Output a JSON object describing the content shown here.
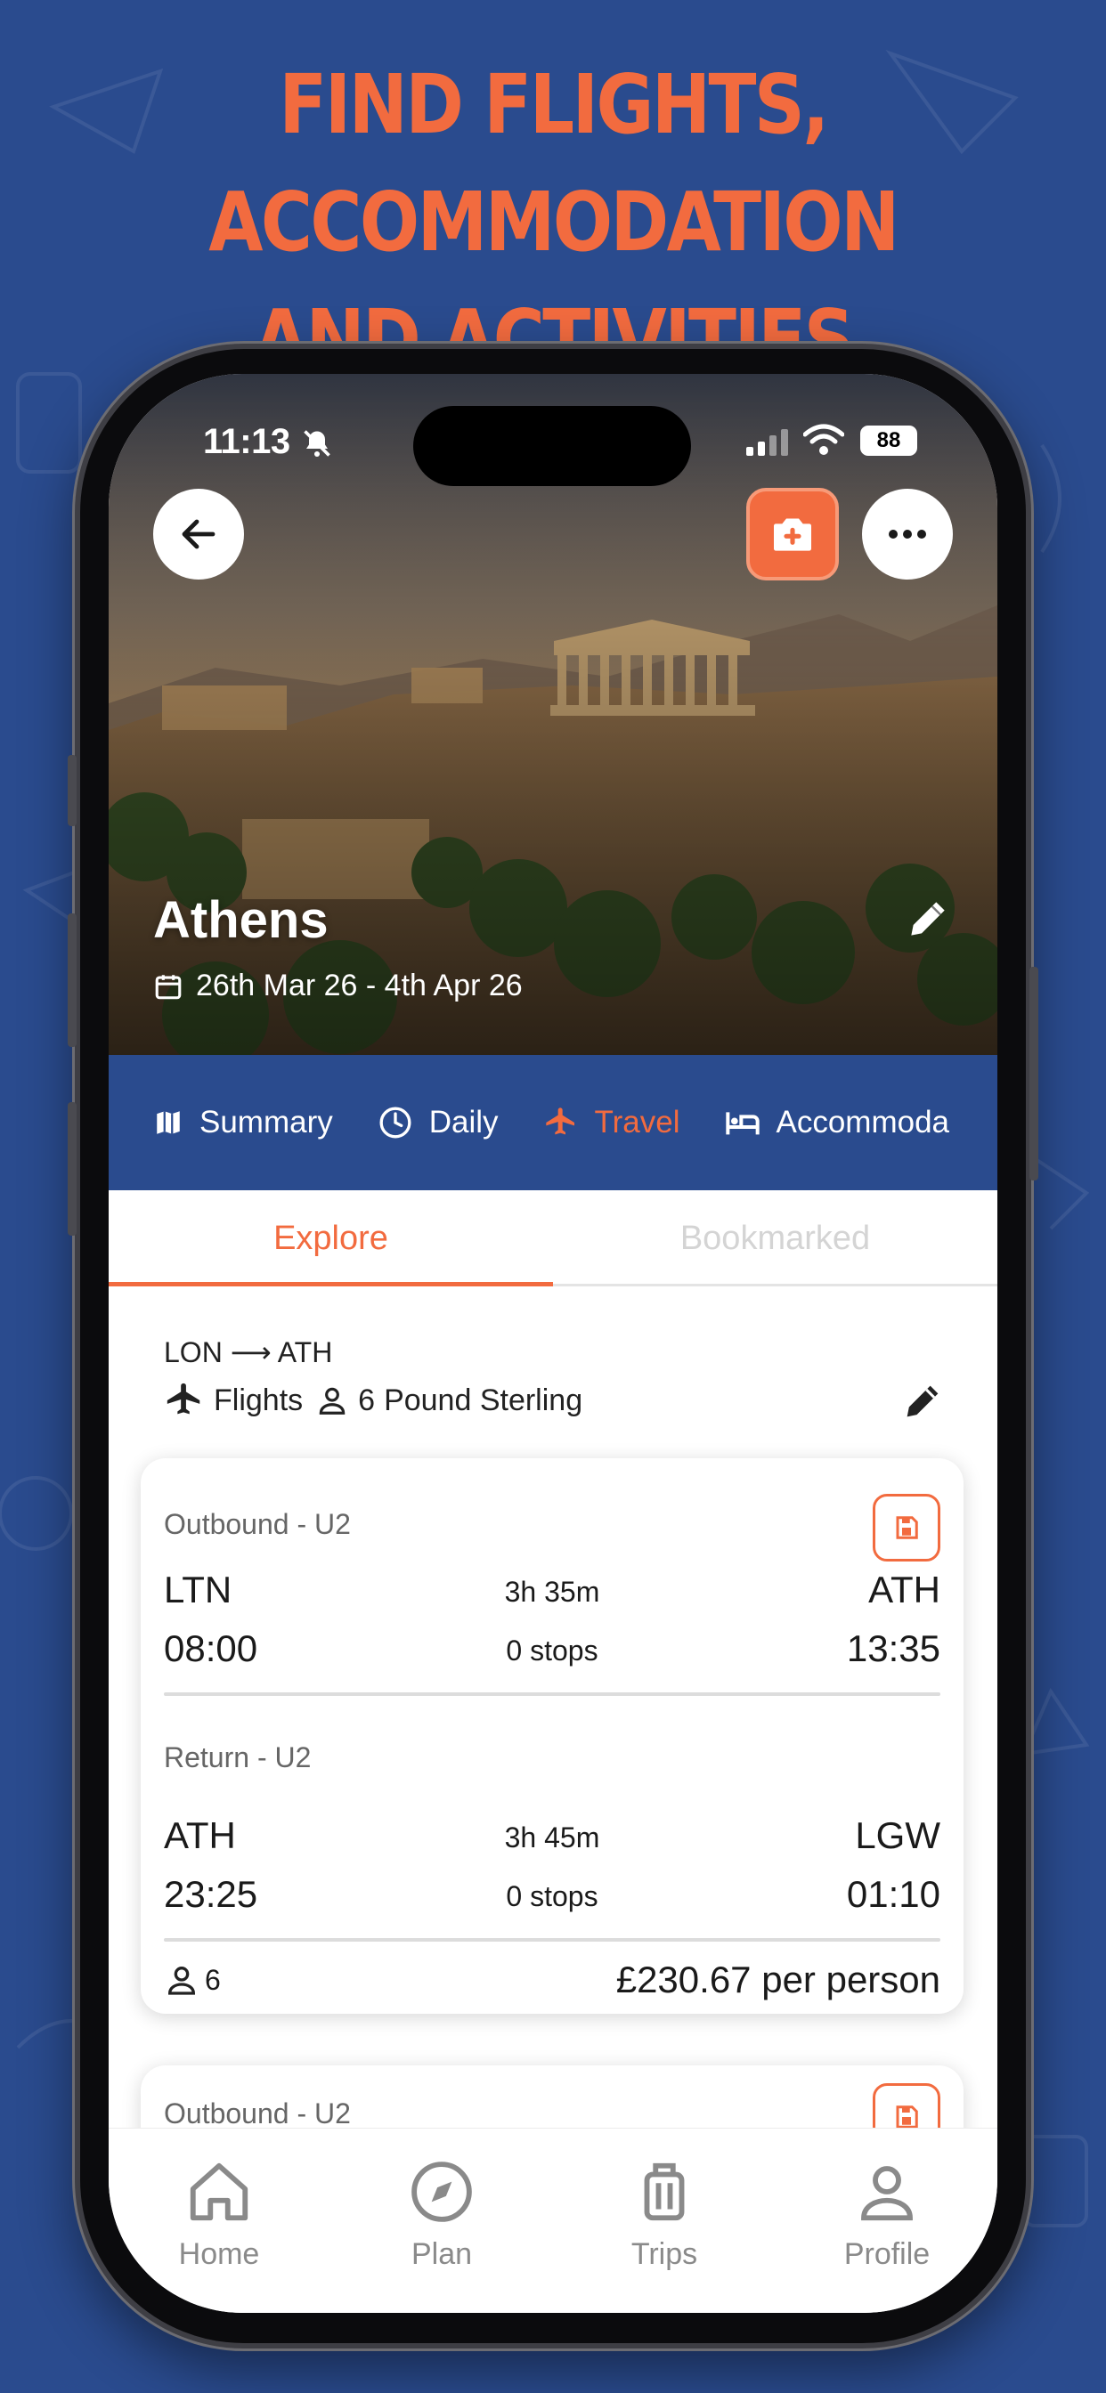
{
  "headline": {
    "line1": "FIND FLIGHTS, ACCOMMODATION",
    "line2": "AND ACTIVITIES"
  },
  "status_bar": {
    "time": "11:13",
    "battery": "88"
  },
  "trip": {
    "city": "Athens",
    "dates": "26th Mar 26 - 4th Apr 26"
  },
  "tabs": [
    {
      "label": "Summary",
      "icon": "map-icon"
    },
    {
      "label": "Daily",
      "icon": "clock-icon"
    },
    {
      "label": "Travel",
      "icon": "plane-icon",
      "active": true
    },
    {
      "label": "Accommoda",
      "icon": "bed-icon"
    }
  ],
  "subtabs": {
    "explore": "Explore",
    "bookmarked": "Bookmarked"
  },
  "search": {
    "route": "LON ⟶ ATH",
    "mode": "Flights",
    "travellers": "6",
    "currency": "Pound Sterling"
  },
  "flight_card": {
    "outbound": {
      "title": "Outbound - U2",
      "from": "LTN",
      "depart": "08:00",
      "duration": "3h 35m",
      "stops": "0 stops",
      "to": "ATH",
      "arrive": "13:35"
    },
    "return": {
      "title": "Return - U2",
      "from": "ATH",
      "depart": "23:25",
      "duration": "3h 45m",
      "stops": "0 stops",
      "to": "LGW",
      "arrive": "01:10"
    },
    "travellers": "6",
    "price": "£230.67 per person"
  },
  "next_card": {
    "title": "Outbound - U2"
  },
  "bottom_nav": [
    {
      "label": "Home",
      "icon": "home-icon"
    },
    {
      "label": "Plan",
      "icon": "compass-icon"
    },
    {
      "label": "Trips",
      "icon": "suitcase-icon"
    },
    {
      "label": "Profile",
      "icon": "person-icon"
    }
  ],
  "colors": {
    "brand_blue": "#2a4b8e",
    "accent_orange": "#f26b3f"
  }
}
